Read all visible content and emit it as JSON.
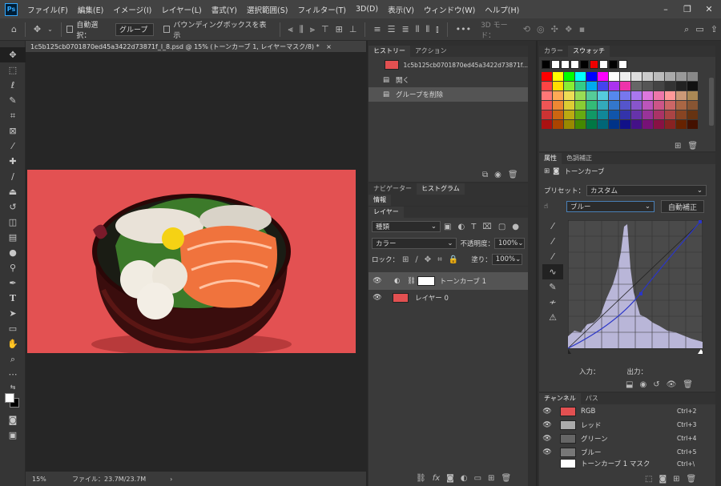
{
  "app": {
    "logo": "Ps"
  },
  "menu": [
    "ファイル(F)",
    "編集(E)",
    "イメージ(I)",
    "レイヤー(L)",
    "書式(Y)",
    "選択範囲(S)",
    "フィルター(T)",
    "3D(D)",
    "表示(V)",
    "ウィンドウ(W)",
    "ヘルプ(H)"
  ],
  "window_controls": {
    "minimize": "–",
    "restore": "❐",
    "close": "✕"
  },
  "options": {
    "auto_select_label": "自動選択：",
    "auto_select_value": "グループ",
    "bounding_box_label": "バウンディングボックスを表示",
    "mode3d_label": "3D モード："
  },
  "document": {
    "tab_title": "1c5b125cb0701870ed45a3422d73871f_l_8.psd @ 15% (トーンカーブ 1, レイヤーマスク/8) *",
    "tab_close": "×",
    "zoom": "15%",
    "file_info": "ファイル：23.7M/23.7M"
  },
  "history": {
    "tabs": [
      "ヒストリー",
      "アクション"
    ],
    "snapshot": "1c5b125cb0701870ed45a3422d73871f...",
    "items": [
      "開く",
      "グループを削除"
    ]
  },
  "mid_tabs": {
    "navigator": "ナビゲーター",
    "histogram": "ヒストグラム",
    "info": "情報"
  },
  "layers": {
    "tab": "レイヤー",
    "filter_kind": "種類",
    "blend_mode": "カラー",
    "opacity_label": "不透明度：",
    "opacity_value": "100%",
    "lock_label": "ロック：",
    "fill_label": "塗り：",
    "fill_value": "100%",
    "items": [
      {
        "name": "トーンカーブ 1",
        "type": "adjustment"
      },
      {
        "name": "レイヤー 0",
        "type": "pixel"
      }
    ]
  },
  "color_panel": {
    "tabs": [
      "カラー",
      "スウォッチ"
    ]
  },
  "properties": {
    "tabs": [
      "属性",
      "色調補正"
    ],
    "title": "トーンカーブ",
    "preset_label": "プリセット：",
    "preset_value": "カスタム",
    "channel_value": "ブルー",
    "auto_label": "自動補正",
    "input_label": "入力：",
    "output_label": "出力："
  },
  "channels": {
    "tabs": [
      "チャンネル",
      "パス"
    ],
    "items": [
      {
        "name": "RGB",
        "shortcut": "Ctrl+2"
      },
      {
        "name": "レッド",
        "shortcut": "Ctrl+3"
      },
      {
        "name": "グリーン",
        "shortcut": "Ctrl+4"
      },
      {
        "name": "ブルー",
        "shortcut": "Ctrl+5"
      },
      {
        "name": "トーンカーブ 1 マスク",
        "shortcut": "Ctrl+\\"
      }
    ]
  },
  "colors": {
    "accent": "#31a8ff",
    "photo_bg": "#e25051",
    "curve": "#2a35c8"
  }
}
